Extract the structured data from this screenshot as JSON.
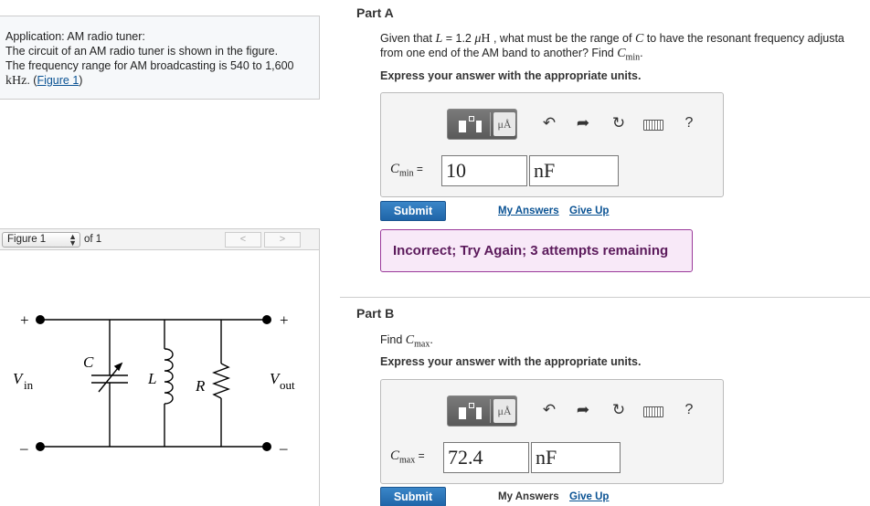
{
  "intro": {
    "line1": "Application: AM radio tuner:",
    "line2": "The circuit of an AM radio tuner is shown in the figure.",
    "line3": "The frequency range for AM broadcasting is 540 to 1,600",
    "unit_khz": "kHz",
    "period": ". (",
    "figure_link": "Figure 1",
    "close": ")"
  },
  "figure_nav": {
    "selected": "Figure 1",
    "of": "of 1",
    "prev": "<",
    "next": ">"
  },
  "circuit": {
    "plus_left": "+",
    "plus_right": "+",
    "minus_left": "–",
    "minus_right": "–",
    "vin": "V",
    "vin_sub": "in",
    "vout": "V",
    "vout_sub": "out",
    "c_label": "C",
    "l_label": "L",
    "r_label": "R"
  },
  "partA": {
    "title": "Part A",
    "q_line1_a": "Given that ",
    "q_L": "L",
    "q_line1_b": " = 1.2 ",
    "q_mu": "μ",
    "q_H": "H",
    "q_line1_c": " , what must be the range of ",
    "q_C": "C",
    "q_line1_d": " to have the resonant frequency adjusta",
    "q_line2_a": "from one end of the AM band to another? Find ",
    "q_Cmin": "C",
    "q_Cmin_sub": "min",
    "q_line2_b": ".",
    "express": "Express your answer with the appropriate units.",
    "label_C": "C",
    "label_sub": "min",
    "label_eq": " =",
    "value": "10",
    "unit": "nF",
    "submit": "Submit",
    "my_answers": "My Answers",
    "give_up": "Give Up",
    "feedback": "Incorrect; Try Again; 3 attempts remaining"
  },
  "partB": {
    "title": "Part B",
    "q_a": "Find ",
    "q_C": "C",
    "q_sub": "max",
    "q_b": ".",
    "express": "Express your answer with the appropriate units.",
    "label_C": "C",
    "label_sub": "max",
    "label_eq": " =",
    "value": "72.4",
    "unit": "nF",
    "submit": "Submit",
    "my_answers": "My Answers",
    "give_up": "Give Up"
  },
  "toolbar": {
    "units_btn": "μÅ",
    "undo": "↶",
    "redo": "➦",
    "reset": "↻",
    "help": "?"
  },
  "colors": {
    "submit": "#2a77bd",
    "feedback_border": "#9a3a9a",
    "feedback_bg": "#f8e9f8",
    "link": "#0b5394"
  }
}
